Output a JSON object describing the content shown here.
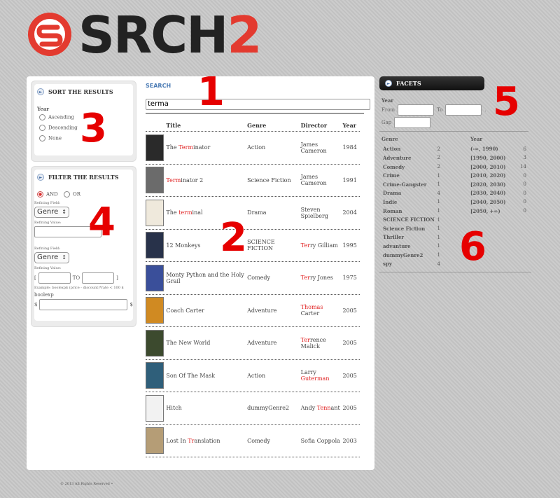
{
  "logo": {
    "text_main": "SRCH",
    "text_accent": "2"
  },
  "annotations": [
    "1",
    "2",
    "3",
    "4",
    "5",
    "6"
  ],
  "sort": {
    "title": "SORT THE RESULTS",
    "field_label": "Year",
    "options": [
      "Ascending",
      "Descending",
      "None"
    ]
  },
  "filter": {
    "title": "FILTER THE RESULTS",
    "logic_options": [
      "AND",
      "OR"
    ],
    "refining_field_label": "Refining Field:",
    "refining_value_label": "Refining Value:",
    "field1_value": "Genre",
    "field2_value": "Genre",
    "range_open": "[",
    "range_to": "TO",
    "range_close": "]",
    "example_text": "Example: boolexp$ (price - discount)*rate < 100 $",
    "boolexp_label": "boolexp",
    "dollar": "$"
  },
  "search": {
    "label": "SEARCH",
    "query": "terma"
  },
  "results": {
    "columns": [
      "Title",
      "Genre",
      "Director",
      "Year"
    ],
    "rows": [
      {
        "title_pre": "The ",
        "title_hl": "Term",
        "title_post": "inator",
        "genre": "Action",
        "dir_pre": "James Cameron",
        "dir_hl": "",
        "dir_post": "",
        "year": "1984",
        "poster_color": "#2a2a2a"
      },
      {
        "title_pre": "",
        "title_hl": "Term",
        "title_post": "inator 2",
        "genre": "Science Fiction",
        "dir_pre": "James Cameron",
        "dir_hl": "",
        "dir_post": "",
        "year": "1991",
        "poster_color": "#6b6b6b"
      },
      {
        "title_pre": "The ",
        "title_hl": "term",
        "title_post": "inal",
        "genre": "Drama",
        "dir_pre": "Steven Spielberg",
        "dir_hl": "",
        "dir_post": "",
        "year": "2004",
        "poster_color": "#efe9dc"
      },
      {
        "title_pre": "12 Monkeys",
        "title_hl": "",
        "title_post": "",
        "genre": "SCIENCE FICTION",
        "dir_pre": "",
        "dir_hl": "Ter",
        "dir_post": "ry Gilliam",
        "year": "1995",
        "poster_color": "#28324a"
      },
      {
        "title_pre": "Monty Python and the Holy Grail",
        "title_hl": "",
        "title_post": "",
        "genre": "Comedy",
        "dir_pre": "",
        "dir_hl": "Ter",
        "dir_post": "ry Jones",
        "year": "1975",
        "poster_color": "#3a4f9a"
      },
      {
        "title_pre": "Coach Carter",
        "title_hl": "",
        "title_post": "",
        "genre": "Adventure",
        "dir_pre": "",
        "dir_hl": "Thomas",
        "dir_post": " Carter",
        "year": "2005",
        "poster_color": "#d08a22"
      },
      {
        "title_pre": "The New World",
        "title_hl": "",
        "title_post": "",
        "genre": "Adventure",
        "dir_pre": "",
        "dir_hl": "Ter",
        "dir_post": "rence Malick",
        "year": "2005",
        "poster_color": "#3c4a2e"
      },
      {
        "title_pre": "Son Of The Mask",
        "title_hl": "",
        "title_post": "",
        "genre": "Action",
        "dir_pre": "Larry ",
        "dir_hl": "Guterman",
        "dir_post": "",
        "year": "2005",
        "poster_color": "#2f5f7a"
      },
      {
        "title_pre": "Hitch",
        "title_hl": "",
        "title_post": "",
        "genre": "dummyGenre2",
        "dir_pre": "Andy ",
        "dir_hl": "Tenn",
        "dir_post": "ant",
        "year": "2005",
        "poster_color": "#f2f2f2"
      },
      {
        "title_pre": "Lost In ",
        "title_hl": "Tr",
        "title_post": "anslation",
        "genre": "Comedy",
        "dir_pre": "Sofia Coppola",
        "dir_hl": "",
        "dir_post": "",
        "year": "2003",
        "poster_color": "#b59d76"
      }
    ]
  },
  "facets": {
    "title": "FACETS",
    "year_label": "Year",
    "from_label": "From",
    "to_label": "To",
    "gap_label": "Gap",
    "year_trailing": ".",
    "genre_header": "Genre",
    "year_header": "Year",
    "genres": [
      {
        "name": "Action",
        "count": "2"
      },
      {
        "name": "Adventure",
        "count": "2"
      },
      {
        "name": "Comedy",
        "count": "2"
      },
      {
        "name": "Crime",
        "count": "1"
      },
      {
        "name": "Crime-Gangster",
        "count": "1"
      },
      {
        "name": "Drama",
        "count": "4"
      },
      {
        "name": "Indie",
        "count": "1"
      },
      {
        "name": "Roman",
        "count": "1"
      },
      {
        "name": "SCIENCE FICTION",
        "count": "1"
      },
      {
        "name": "Science Fiction",
        "count": "1"
      },
      {
        "name": "Thriller",
        "count": "1"
      },
      {
        "name": "advanture",
        "count": "1"
      },
      {
        "name": "dummyGenre2",
        "count": "1"
      },
      {
        "name": "spy",
        "count": "4"
      }
    ],
    "years": [
      {
        "range": "(-∞, 1990)",
        "count": "6"
      },
      {
        "range": "[1990, 2000)",
        "count": "3"
      },
      {
        "range": "[2000, 2010)",
        "count": "14"
      },
      {
        "range": "[2010, 2020)",
        "count": "0"
      },
      {
        "range": "[2020, 2030)",
        "count": "0"
      },
      {
        "range": "[2030, 2040)",
        "count": "0"
      },
      {
        "range": "[2040, 2050)",
        "count": "0"
      },
      {
        "range": "[2050, +∞)",
        "count": "0"
      }
    ]
  },
  "footer": {
    "text": "© 2013 All Rights Reserved •"
  },
  "colors": {
    "accent": "#e33a2f",
    "highlight": "#e02020",
    "link": "#4c7cb5"
  }
}
